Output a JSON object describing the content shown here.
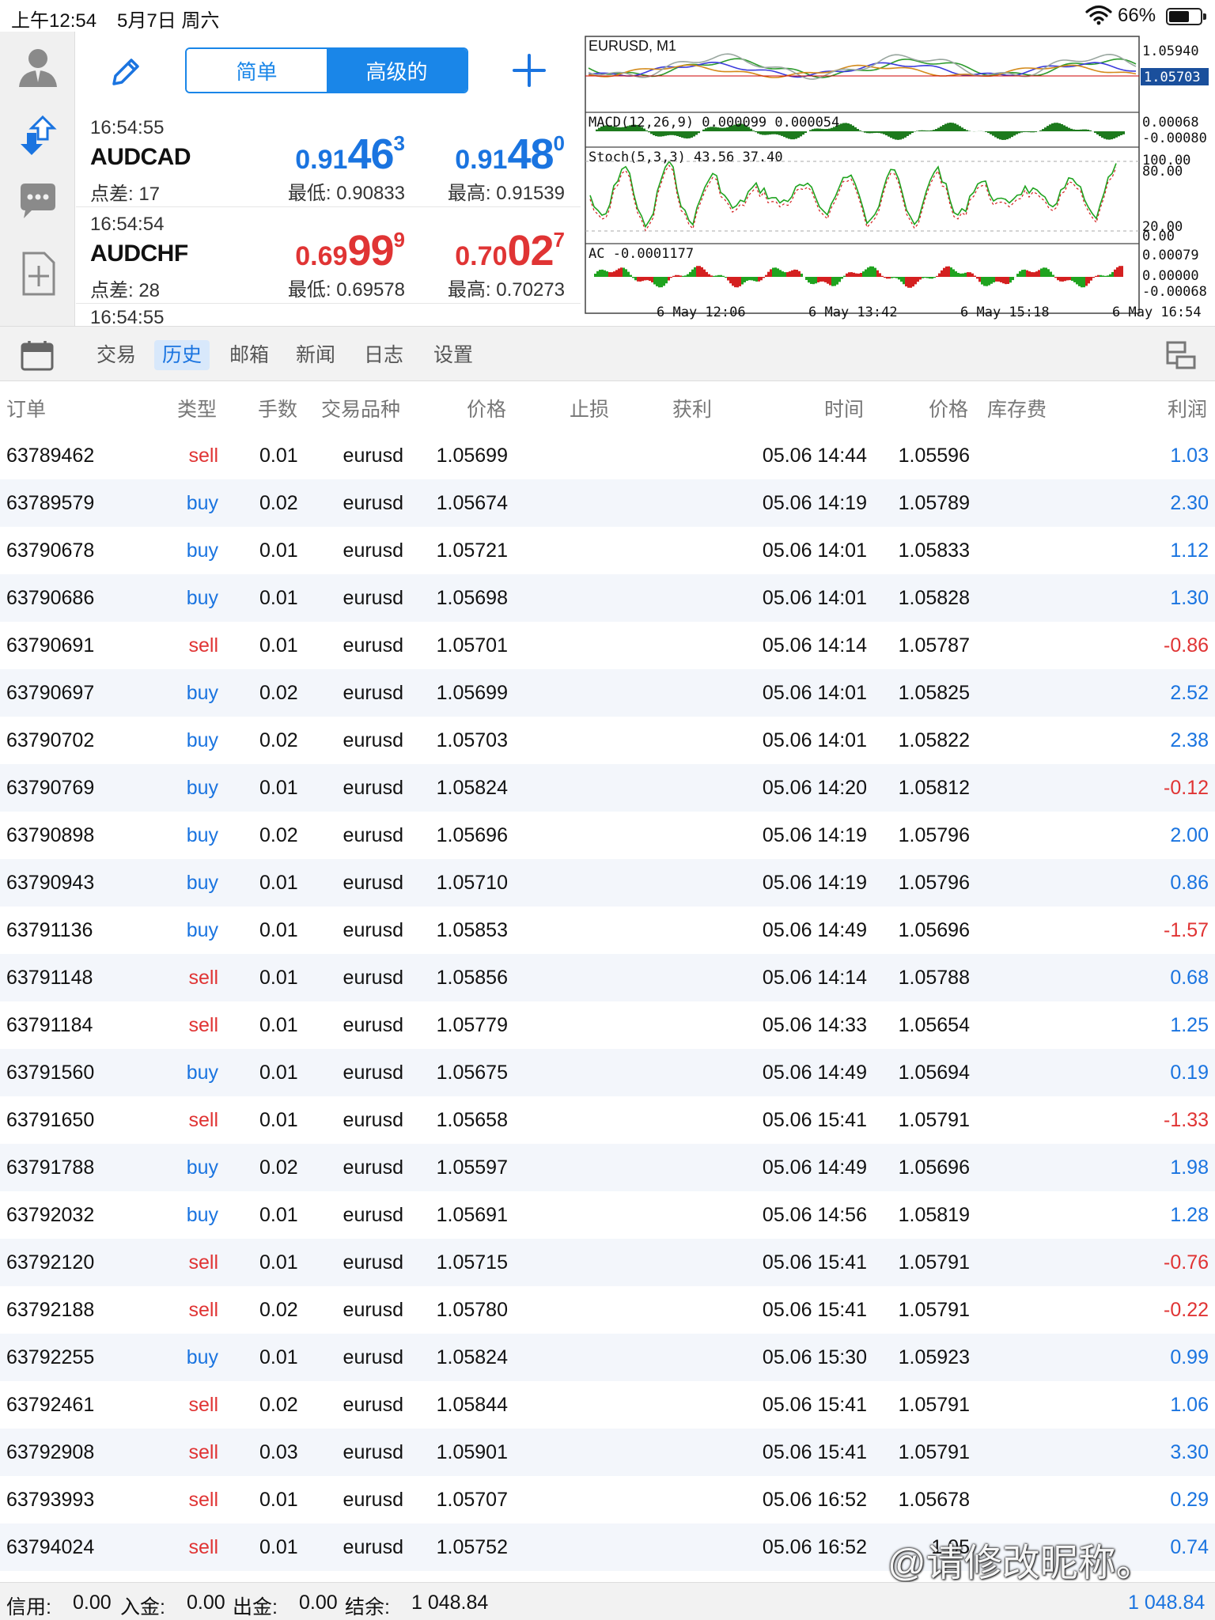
{
  "status_bar": {
    "time": "上午12:54",
    "date": "5月7日 周六",
    "battery_pct": "66%",
    "battery_level": 0.66
  },
  "quotes_header": {
    "seg_simple": "简单",
    "seg_advanced": "高级的"
  },
  "quotes": [
    {
      "time": "16:54:55",
      "symbol": "AUDCAD",
      "spread": "点差: 17",
      "bid": {
        "pre": "0.91",
        "big": "46",
        "sup": "3"
      },
      "ask": {
        "pre": "0.91",
        "big": "48",
        "sup": "0"
      },
      "low": "最低: 0.90833",
      "high": "最高: 0.91539",
      "color": "#1a74e0"
    },
    {
      "time": "16:54:54",
      "symbol": "AUDCHF",
      "spread": "点差: 28",
      "bid": {
        "pre": "0.69",
        "big": "99",
        "sup": "9"
      },
      "ask": {
        "pre": "0.70",
        "big": "02",
        "sup": "7"
      },
      "low": "最低: 0.69578",
      "high": "最高: 0.70273",
      "color": "#e03434"
    }
  ],
  "quotes_partial_time": "16:54:55",
  "chart": {
    "title": "EURUSD, M1",
    "price_scale": [
      "1.05940"
    ],
    "current_price": "1.05703",
    "macd_label": "MACD(12,26,9) 0.000099 0.000054",
    "macd_scale": [
      "0.00068",
      "-0.00080"
    ],
    "stoch_label": "Stoch(5,3,3) 43.56 37.40",
    "stoch_scale": [
      "100.00",
      "80.00",
      "20.00",
      "0.00"
    ],
    "ac_label": "AC -0.0001177",
    "ac_scale": [
      "0.00079",
      "0.00000",
      "-0.00068"
    ],
    "time_labels": [
      "6 May 12:06",
      "6 May 13:42",
      "6 May 15:18",
      "6 May 16:54"
    ],
    "colors": {
      "up": "#1fa31f",
      "down": "#d42020",
      "price_line": "#cc0000",
      "current_bg": "#1a4f9c"
    }
  },
  "tabs": {
    "trade": "交易",
    "history": "历史",
    "mailbox": "邮箱",
    "news": "新闻",
    "journal": "日志",
    "settings": "设置"
  },
  "columns": {
    "order": "订单",
    "type": "类型",
    "lots": "手数",
    "symbol": "交易品种",
    "price": "价格",
    "sl": "止损",
    "tp": "获利",
    "time": "时间",
    "close_price": "价格",
    "swap": "库存费",
    "profit": "利润"
  },
  "history": [
    [
      "63789462",
      "sell",
      "0.01",
      "eurusd",
      "1.05699",
      "05.06 14:44",
      "1.05596",
      "1.03"
    ],
    [
      "63789579",
      "buy",
      "0.02",
      "eurusd",
      "1.05674",
      "05.06 14:19",
      "1.05789",
      "2.30"
    ],
    [
      "63790678",
      "buy",
      "0.01",
      "eurusd",
      "1.05721",
      "05.06 14:01",
      "1.05833",
      "1.12"
    ],
    [
      "63790686",
      "buy",
      "0.01",
      "eurusd",
      "1.05698",
      "05.06 14:01",
      "1.05828",
      "1.30"
    ],
    [
      "63790691",
      "sell",
      "0.01",
      "eurusd",
      "1.05701",
      "05.06 14:14",
      "1.05787",
      "-0.86"
    ],
    [
      "63790697",
      "buy",
      "0.02",
      "eurusd",
      "1.05699",
      "05.06 14:01",
      "1.05825",
      "2.52"
    ],
    [
      "63790702",
      "buy",
      "0.02",
      "eurusd",
      "1.05703",
      "05.06 14:01",
      "1.05822",
      "2.38"
    ],
    [
      "63790769",
      "buy",
      "0.01",
      "eurusd",
      "1.05824",
      "05.06 14:20",
      "1.05812",
      "-0.12"
    ],
    [
      "63790898",
      "buy",
      "0.02",
      "eurusd",
      "1.05696",
      "05.06 14:19",
      "1.05796",
      "2.00"
    ],
    [
      "63790943",
      "buy",
      "0.01",
      "eurusd",
      "1.05710",
      "05.06 14:19",
      "1.05796",
      "0.86"
    ],
    [
      "63791136",
      "buy",
      "0.01",
      "eurusd",
      "1.05853",
      "05.06 14:49",
      "1.05696",
      "-1.57"
    ],
    [
      "63791148",
      "sell",
      "0.01",
      "eurusd",
      "1.05856",
      "05.06 14:14",
      "1.05788",
      "0.68"
    ],
    [
      "63791184",
      "sell",
      "0.01",
      "eurusd",
      "1.05779",
      "05.06 14:33",
      "1.05654",
      "1.25"
    ],
    [
      "63791560",
      "buy",
      "0.01",
      "eurusd",
      "1.05675",
      "05.06 14:49",
      "1.05694",
      "0.19"
    ],
    [
      "63791650",
      "sell",
      "0.01",
      "eurusd",
      "1.05658",
      "05.06 15:41",
      "1.05791",
      "-1.33"
    ],
    [
      "63791788",
      "buy",
      "0.02",
      "eurusd",
      "1.05597",
      "05.06 14:49",
      "1.05696",
      "1.98"
    ],
    [
      "63792032",
      "buy",
      "0.01",
      "eurusd",
      "1.05691",
      "05.06 14:56",
      "1.05819",
      "1.28"
    ],
    [
      "63792120",
      "sell",
      "0.01",
      "eurusd",
      "1.05715",
      "05.06 15:41",
      "1.05791",
      "-0.76"
    ],
    [
      "63792188",
      "sell",
      "0.02",
      "eurusd",
      "1.05780",
      "05.06 15:41",
      "1.05791",
      "-0.22"
    ],
    [
      "63792255",
      "buy",
      "0.01",
      "eurusd",
      "1.05824",
      "05.06 15:30",
      "1.05923",
      "0.99"
    ],
    [
      "63792461",
      "sell",
      "0.02",
      "eurusd",
      "1.05844",
      "05.06 15:41",
      "1.05791",
      "1.06"
    ],
    [
      "63792908",
      "sell",
      "0.03",
      "eurusd",
      "1.05901",
      "05.06 15:41",
      "1.05791",
      "3.30"
    ],
    [
      "63793993",
      "sell",
      "0.01",
      "eurusd",
      "1.05707",
      "05.06 16:52",
      "1.05678",
      "0.29"
    ],
    [
      "63794024",
      "sell",
      "0.01",
      "eurusd",
      "1.05752",
      "05.06 16:52",
      "1.05",
      "0.74"
    ]
  ],
  "footer": {
    "credit_label": "信用:",
    "credit": "0.00",
    "deposit_label": "入金:",
    "deposit": "0.00",
    "withdraw_label": "出金:",
    "withdraw": "0.00",
    "balance_label": "结余:",
    "balance": "1 048.84",
    "total": "1 048.84"
  },
  "watermark": "@请修改昵称。",
  "colors": {
    "accent": "#1a74e0",
    "sell": "#e03434",
    "buy": "#1a74e0",
    "loss": "#e03434"
  }
}
